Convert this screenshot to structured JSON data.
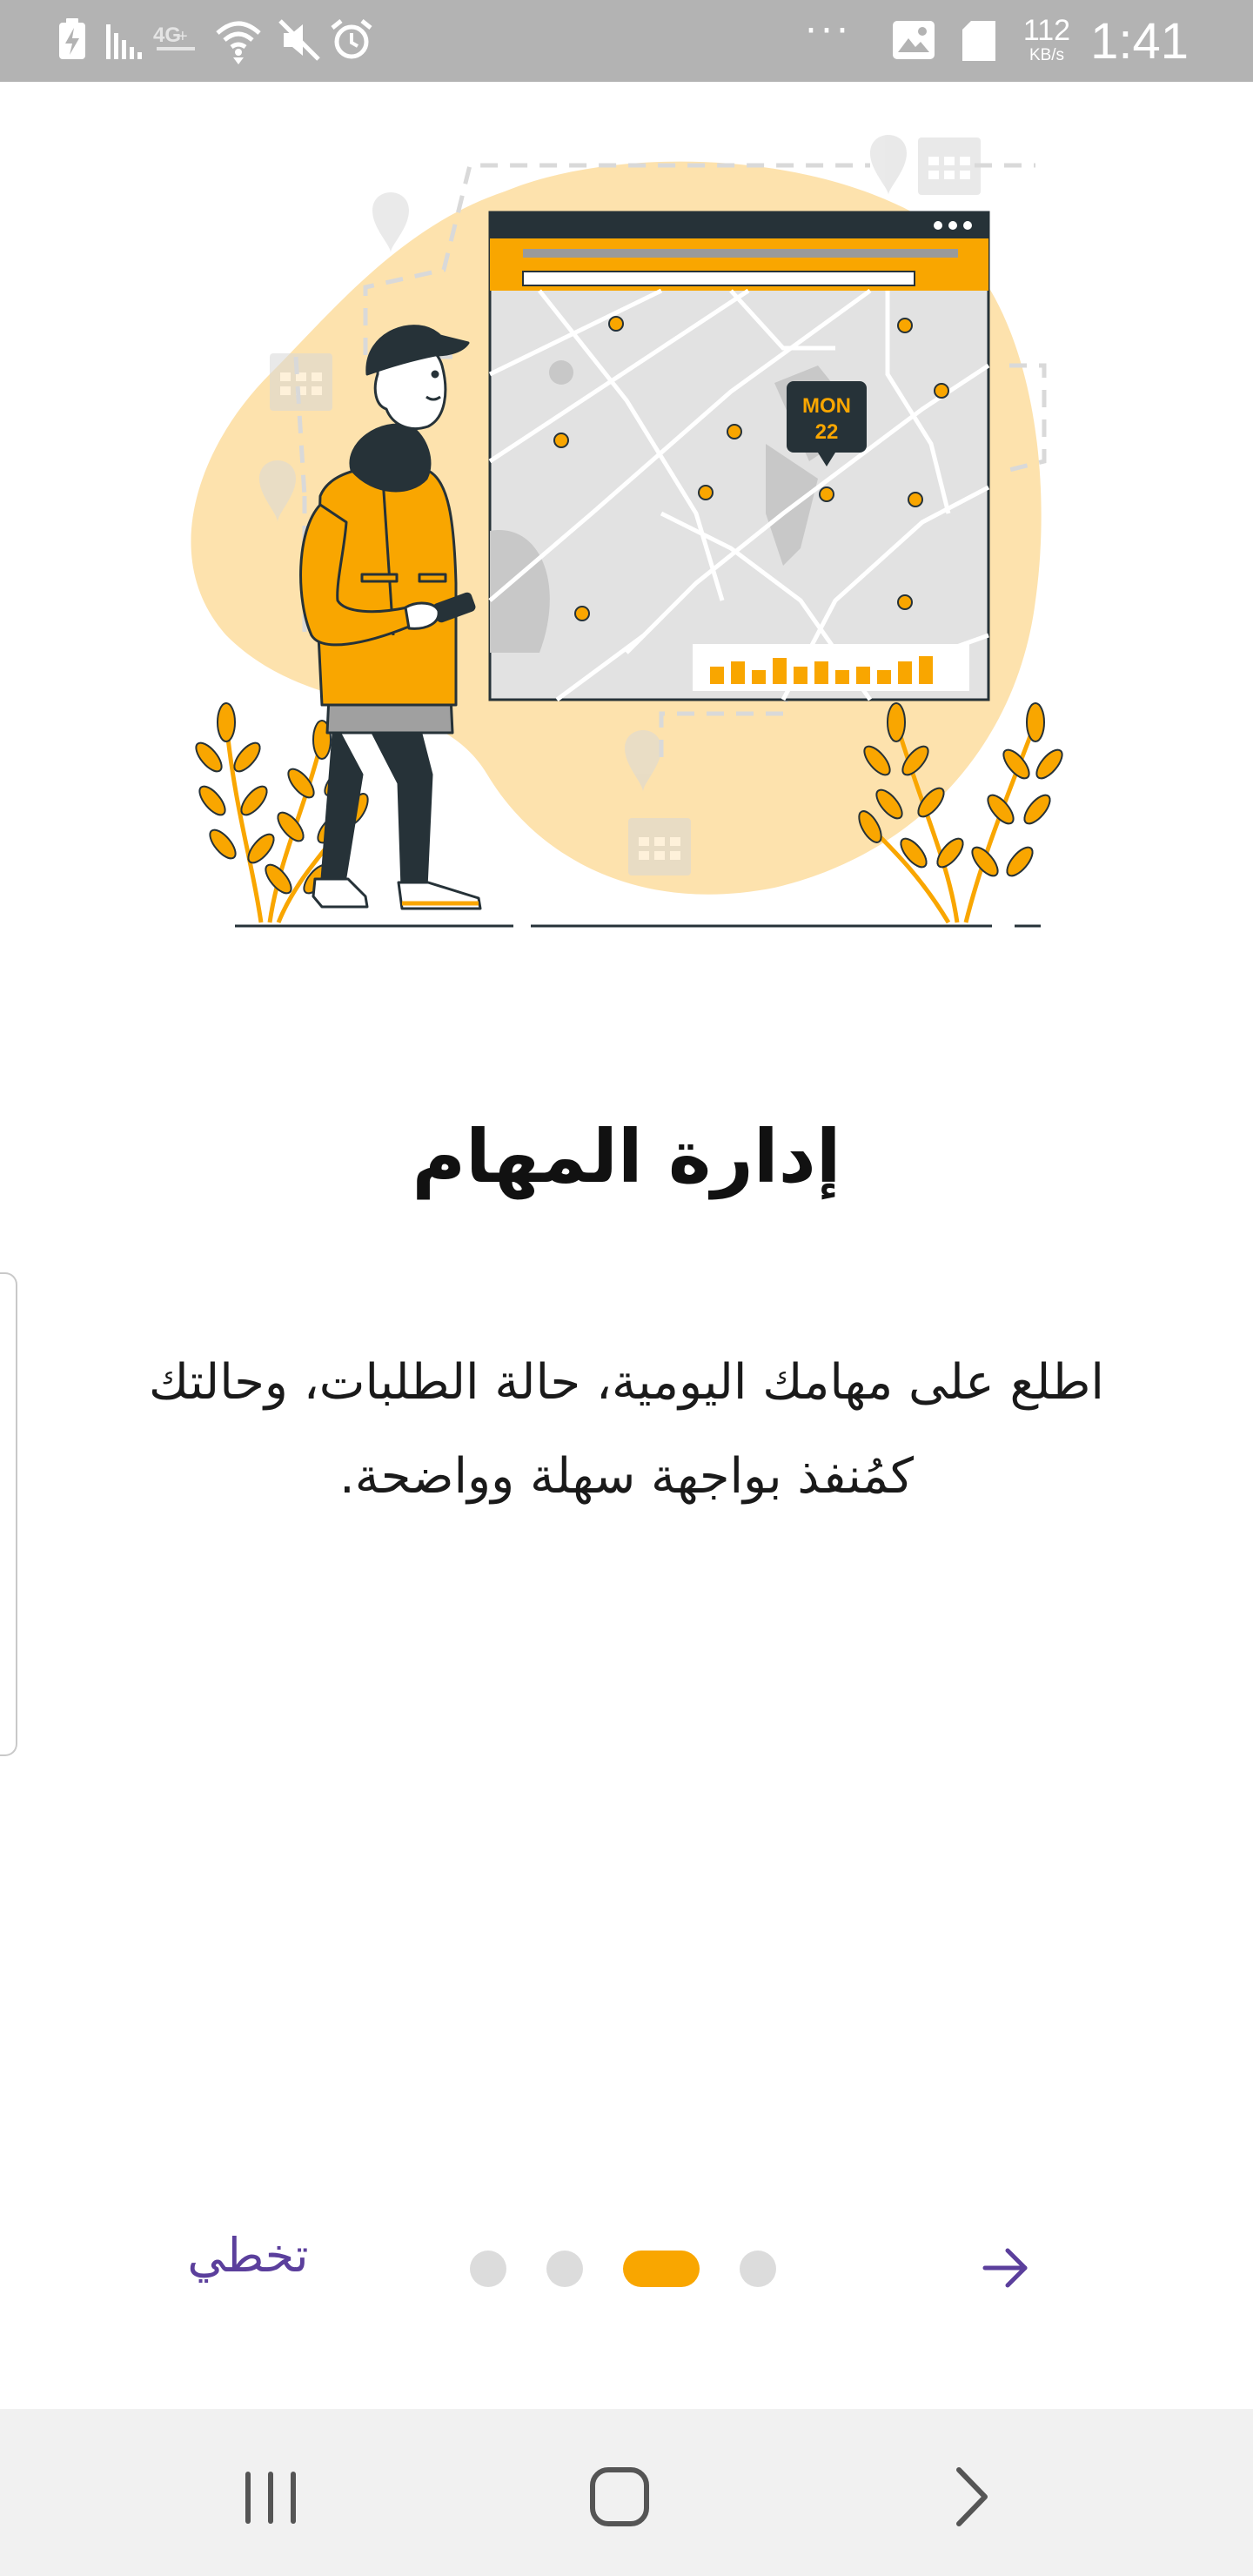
{
  "status_bar": {
    "net_speed_value": "112",
    "net_speed_unit": "KB/s",
    "time": "1:41",
    "more_indicator": "···",
    "icons": [
      "charging-icon",
      "signal-icon",
      "lte-icon",
      "wifi-icon",
      "mute-icon",
      "alarm-icon",
      "image-icon",
      "sd-card-icon"
    ]
  },
  "illustration": {
    "calendar_day": "MON",
    "calendar_date": "22",
    "accent_color": "#f9a600",
    "blob_color": "#fde2ad"
  },
  "onboarding": {
    "title": "إدارة المهام",
    "description": "اطلع على مهامك اليومية، حالة الطلبات، وحالتك كمُنفذ بواجهة سهلة وواضحة.",
    "skip_label": "تخطي",
    "pager": {
      "total_pages": 4,
      "active_page": 3
    }
  },
  "nav_bar": {
    "icons": [
      "recent-apps-icon",
      "home-icon",
      "back-icon"
    ]
  },
  "colors": {
    "accent": "#f9a600",
    "link": "#5b3f9c",
    "inactive_dot": "#dcdcdc",
    "status_bar": "#b3b3b3",
    "nav_bar": "#f1f1f1"
  }
}
